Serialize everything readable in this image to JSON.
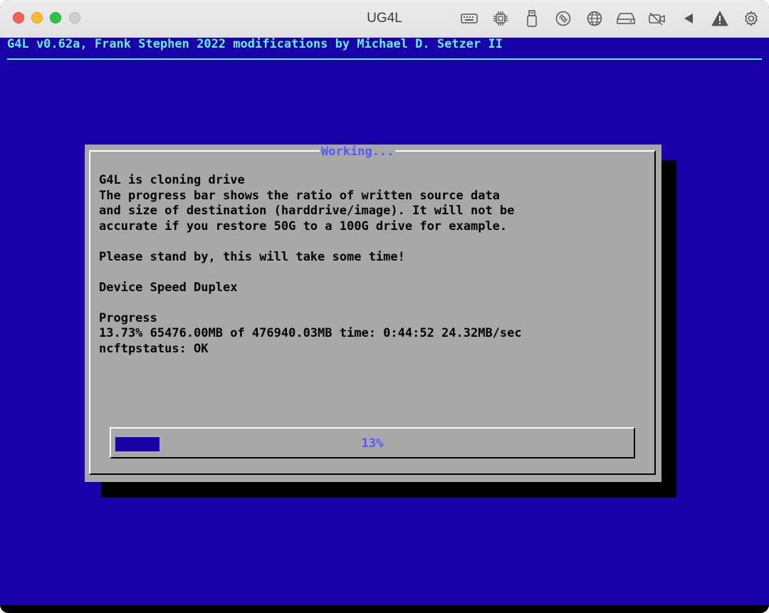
{
  "window": {
    "title": "UG4L",
    "toolbar_icons": [
      "keyboard-icon",
      "cpu-icon",
      "usb-drive-icon",
      "disc-icon",
      "globe-icon",
      "hard-drive-icon",
      "camera-off-icon",
      "audio-icon",
      "warning-icon",
      "settings-icon"
    ]
  },
  "terminal": {
    "header": "G4L v0.62a, Frank Stephen 2022 modifications by Michael D. Setzer II",
    "dialog": {
      "title": "Working...",
      "lines": {
        "l1": "G4L is cloning drive",
        "l2": "The progress bar shows the ratio of written source data",
        "l3": "and size of destination (harddrive/image). It will not be",
        "l4": "accurate if you restore 50G to a 100G drive for example.",
        "l5": "Please stand by, this will take some time!",
        "l6": "Device Speed Duplex",
        "l7": "Progress",
        "l8": "13.73% 65476.00MB of 476940.03MB time: 0:44:52 24.32MB/sec",
        "l9": "ncftpstatus: OK"
      },
      "progress": {
        "label": "13%",
        "fraction": 0.13
      }
    }
  },
  "colors": {
    "screen_bg": "#1a00a8",
    "header_fg": "#5ef1ff",
    "dialog_bg": "#a8a8a8",
    "accent": "#5757ff"
  }
}
